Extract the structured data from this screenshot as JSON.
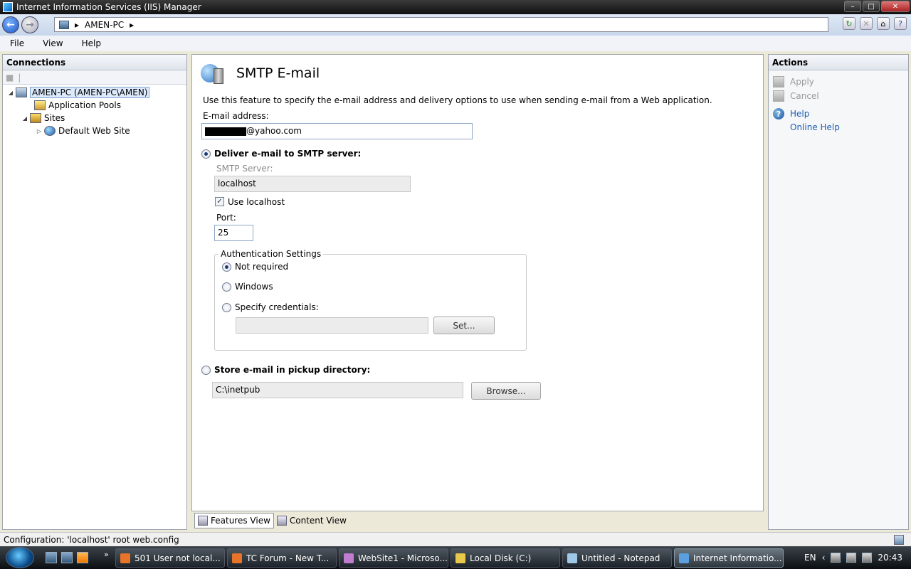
{
  "window": {
    "title": "Internet Information Services (IIS) Manager"
  },
  "address": {
    "segments": [
      "AMEN-PC"
    ]
  },
  "menu": [
    "File",
    "View",
    "Help"
  ],
  "connections": {
    "header": "Connections",
    "tree": [
      {
        "label": "AMEN-PC (AMEN-PC\\AMEN)",
        "icon": "server-icon"
      },
      {
        "label": "Application Pools",
        "icon": "app-pool-icon"
      },
      {
        "label": "Sites",
        "icon": "sites-folder-icon"
      },
      {
        "label": "Default Web Site",
        "icon": "globe-icon"
      }
    ]
  },
  "feature": {
    "title": "SMTP E-mail",
    "description": "Use this feature to specify the e-mail address and delivery options to use when sending e-mail from a Web application.",
    "email_label": "E-mail address:",
    "email_value": "@yahoo.com",
    "deliver_label": "Deliver e-mail to SMTP server:",
    "smtp_server_label": "SMTP Server:",
    "smtp_server_value": "localhost",
    "use_localhost_label": "Use localhost",
    "port_label": "Port:",
    "port_value": "25",
    "auth_legend": "Authentication Settings",
    "auth_not_required": "Not required",
    "auth_windows": "Windows",
    "auth_specify": "Specify credentials:",
    "set_button": "Set...",
    "store_label": "Store e-mail in pickup directory:",
    "pickup_value": "C:\\inetpub",
    "browse_button": "Browse..."
  },
  "viewtabs": {
    "features": "Features View",
    "content": "Content View"
  },
  "actions": {
    "header": "Actions",
    "apply": "Apply",
    "cancel": "Cancel",
    "help": "Help",
    "online_help": "Online Help"
  },
  "status": {
    "text": "Configuration: 'localhost' root web.config"
  },
  "taskbar": {
    "tasks": [
      {
        "label": "501 User not local...",
        "color": "#e8742a"
      },
      {
        "label": "TC Forum - New T...",
        "color": "#e8742a"
      },
      {
        "label": "WebSite1 - Microso...",
        "color": "#c07dd0"
      },
      {
        "label": "Local Disk (C:)",
        "color": "#e8c84a"
      },
      {
        "label": "Untitled - Notepad",
        "color": "#9fc7e8"
      },
      {
        "label": "Internet Informatio...",
        "color": "#5aa0e0"
      }
    ],
    "lang": "EN",
    "clock": "20:43"
  },
  "colors": {
    "link": "#1a5fb4",
    "selection": "#dceafc"
  }
}
